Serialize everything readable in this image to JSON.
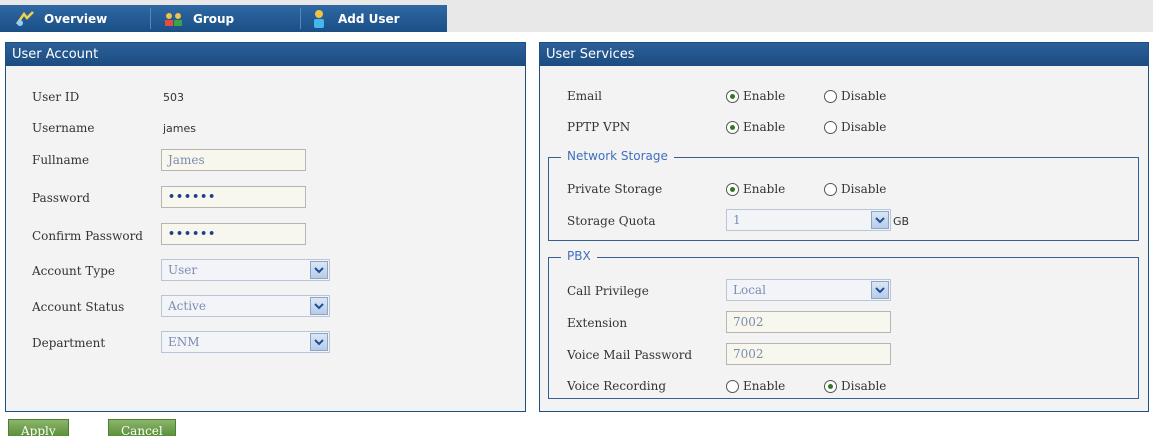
{
  "tabs": [
    {
      "label": "Overview",
      "icon": "overview-icon"
    },
    {
      "label": "Group",
      "icon": "group-icon"
    },
    {
      "label": "Add User",
      "icon": "add-user-icon"
    }
  ],
  "user_account": {
    "title": "User Account",
    "user_id_label": "User ID",
    "user_id_value": "503",
    "username_label": "Username",
    "username_value": "james",
    "fullname_label": "Fullname",
    "fullname_value": "James",
    "password_label": "Password",
    "password_value": "••••••",
    "confirm_password_label": "Confirm Password",
    "confirm_password_value": "••••••",
    "account_type_label": "Account Type",
    "account_type_value": "User",
    "account_status_label": "Account Status",
    "account_status_value": "Active",
    "department_label": "Department",
    "department_value": "ENM"
  },
  "user_services": {
    "title": "User Services",
    "email_label": "Email",
    "pptp_label": "PPTP VPN",
    "enable_label": "Enable",
    "disable_label": "Disable",
    "email_selected": "Enable",
    "pptp_selected": "Enable",
    "network_storage": {
      "legend": "Network Storage",
      "private_storage_label": "Private Storage",
      "private_storage_selected": "Enable",
      "storage_quota_label": "Storage Quota",
      "storage_quota_value": "1",
      "storage_quota_unit": "GB"
    },
    "pbx": {
      "legend": "PBX",
      "call_privilege_label": "Call Privilege",
      "call_privilege_value": "Local",
      "extension_label": "Extension",
      "extension_value": "7002",
      "voice_mail_password_label": "Voice Mail Password",
      "voice_mail_password_value": "7002",
      "voice_recording_label": "Voice Recording",
      "voice_recording_selected": "Disable"
    }
  },
  "actions": {
    "apply_label": "Apply",
    "cancel_label": "Cancel"
  },
  "colors": {
    "header_blue": "#1b4c80",
    "legend_blue": "#3f6fc0",
    "button_green": "#6b9d48"
  }
}
